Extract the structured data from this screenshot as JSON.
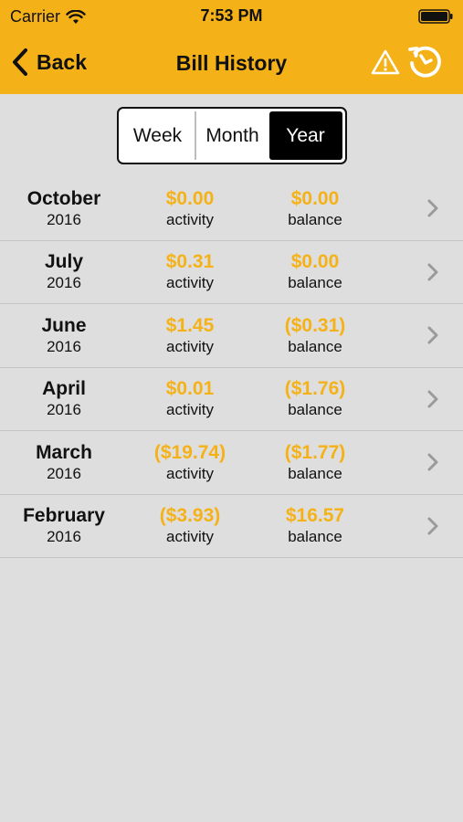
{
  "status_bar": {
    "carrier": "Carrier",
    "time": "7:53 PM",
    "icons": [
      "wifi-icon",
      "battery-icon"
    ]
  },
  "nav": {
    "back_label": "Back",
    "title": "Bill History",
    "icons": [
      "chevron-left-icon",
      "warning-icon",
      "history-icon"
    ]
  },
  "segments": [
    {
      "label": "Week",
      "selected": false
    },
    {
      "label": "Month",
      "selected": false
    },
    {
      "label": "Year",
      "selected": true
    }
  ],
  "bills": [
    {
      "month": "October",
      "year": "2016",
      "activity": "$0.00",
      "activity_label": "activity",
      "balance": "$0.00",
      "balance_label": "balance"
    },
    {
      "month": "July",
      "year": "2016",
      "activity": "$0.31",
      "activity_label": "activity",
      "balance": "$0.00",
      "balance_label": "balance"
    },
    {
      "month": "June",
      "year": "2016",
      "activity": "$1.45",
      "activity_label": "activity",
      "balance": "($0.31)",
      "balance_label": "balance"
    },
    {
      "month": "April",
      "year": "2016",
      "activity": "$0.01",
      "activity_label": "activity",
      "balance": "($1.76)",
      "balance_label": "balance"
    },
    {
      "month": "March",
      "year": "2016",
      "activity": "($19.74)",
      "activity_label": "activity",
      "balance": "($1.77)",
      "balance_label": "balance"
    },
    {
      "month": "February",
      "year": "2016",
      "activity": "($3.93)",
      "activity_label": "activity",
      "balance": "$16.57",
      "balance_label": "balance"
    }
  ],
  "colors": {
    "accent": "#f5b218",
    "background": "#dedede",
    "text": "#111111"
  }
}
